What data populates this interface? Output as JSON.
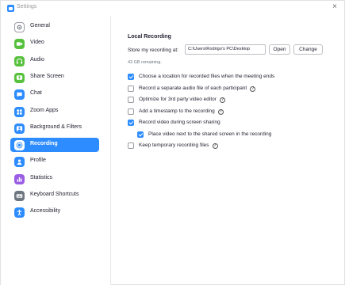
{
  "window": {
    "title": "Settings",
    "close_glyph": "×"
  },
  "sidebar": {
    "items": [
      {
        "label": "General",
        "icon": "gear-icon",
        "color": "#ffffff",
        "border": "#9a9aa2",
        "glyph": "gear",
        "active": false
      },
      {
        "label": "Video",
        "icon": "video-icon",
        "color": "#57c13e",
        "glyph": "video",
        "active": false
      },
      {
        "label": "Audio",
        "icon": "headphones-icon",
        "color": "#57c13e",
        "glyph": "headphones",
        "active": false
      },
      {
        "label": "Share Screen",
        "icon": "share-screen-icon",
        "color": "#57c13e",
        "glyph": "share",
        "active": false
      },
      {
        "label": "Chat",
        "icon": "chat-icon",
        "color": "#2d8cff",
        "glyph": "chat",
        "active": false
      },
      {
        "label": "Zoom Apps",
        "icon": "apps-icon",
        "color": "#2d8cff",
        "glyph": "apps",
        "active": false
      },
      {
        "label": "Background & Filters",
        "icon": "background-icon",
        "color": "#2d8cff",
        "glyph": "bg",
        "active": false
      },
      {
        "label": "Recording",
        "icon": "recording-icon",
        "color": "#ffffff",
        "glyph": "rec",
        "active": true
      },
      {
        "label": "Profile",
        "icon": "profile-icon",
        "color": "#2d8cff",
        "glyph": "profile",
        "active": false
      },
      {
        "label": "Statistics",
        "icon": "statistics-icon",
        "color": "#9b5de5",
        "glyph": "stats",
        "active": false
      },
      {
        "label": "Keyboard Shortcuts",
        "icon": "keyboard-icon",
        "color": "#6e7680",
        "glyph": "keyboard",
        "active": false
      },
      {
        "label": "Accessibility",
        "icon": "accessibility-icon",
        "color": "#2d8cff",
        "glyph": "access",
        "active": false
      }
    ]
  },
  "recording": {
    "section_title": "Local Recording",
    "store_label": "Store my recording at:",
    "path_value": "C:\\Users\\Rodrigo's PC\\Desktop",
    "open_label": "Open",
    "change_label": "Change",
    "remaining": "43 GB remaining.",
    "options": [
      {
        "label": "Choose a location for recorded files when the meeting ends",
        "checked": true,
        "help": false,
        "indent": false
      },
      {
        "label": "Record a separate audio file of each participant",
        "checked": false,
        "help": true,
        "indent": false
      },
      {
        "label": "Optimize for 3rd party video editor",
        "checked": false,
        "help": true,
        "indent": false
      },
      {
        "label": "Add a timestamp to the recording",
        "checked": false,
        "help": true,
        "indent": false
      },
      {
        "label": "Record video during screen sharing",
        "checked": true,
        "help": false,
        "indent": false
      },
      {
        "label": "Place video next to the shared screen in the recording",
        "checked": true,
        "help": false,
        "indent": true
      },
      {
        "label": "Keep temporary recording files",
        "checked": false,
        "help": true,
        "indent": false
      }
    ],
    "help_glyph": "?"
  },
  "colors": {
    "accent": "#2d8cff",
    "text": "#232333"
  }
}
